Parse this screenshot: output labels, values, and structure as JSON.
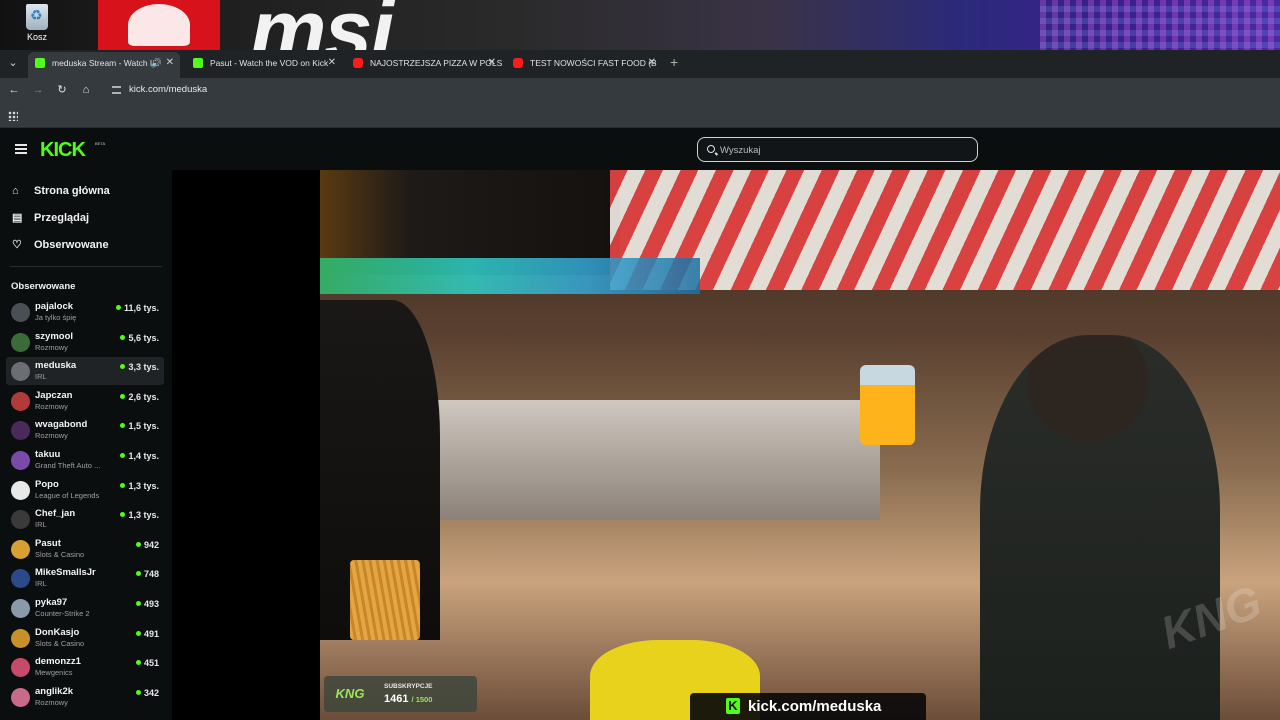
{
  "desktop": {
    "recycle_bin_label": "Kosz"
  },
  "browser": {
    "tabs": [
      {
        "title": "meduska Stream - Watch Li",
        "favicon": "kick-icon",
        "active": true
      },
      {
        "title": "Pasut - Watch the VOD on Kick",
        "favicon": "kick-icon",
        "active": false
      },
      {
        "title": "NAJOSTRZEJSZA PIZZA W POLS",
        "favicon": "youtube-icon",
        "active": false
      },
      {
        "title": "TEST NOWOŚCI FAST FOOD (B",
        "favicon": "youtube-icon",
        "active": false
      }
    ],
    "url": "kick.com/meduska"
  },
  "kick": {
    "logo": "KICK",
    "logo_badge": "BETA",
    "search_placeholder": "Wyszukaj",
    "nav": [
      {
        "label": "Strona główna",
        "icon": "home-icon"
      },
      {
        "label": "Przeglądaj",
        "icon": "browse-icon"
      },
      {
        "label": "Obserwowane",
        "icon": "heart-icon"
      }
    ],
    "followed_title": "Obserwowane",
    "channels": [
      {
        "name": "pajalock",
        "category": "Ja tylko śpię",
        "viewers": "11,6 tys.",
        "avatar_color": "#4a4f55"
      },
      {
        "name": "szymool",
        "category": "Rozmowy",
        "viewers": "5,6 tys.",
        "avatar_color": "#3c6b3a"
      },
      {
        "name": "meduska",
        "category": "IRL",
        "viewers": "3,3 tys.",
        "avatar_color": "#6b6f73",
        "selected": true
      },
      {
        "name": "Japczan",
        "category": "Rozmowy",
        "viewers": "2,6 tys.",
        "avatar_color": "#b23a3a"
      },
      {
        "name": "wvagabond",
        "category": "Rozmowy",
        "viewers": "1,5 tys.",
        "avatar_color": "#4a2a5a"
      },
      {
        "name": "takuu",
        "category": "Grand Theft Auto ...",
        "viewers": "1,4 tys.",
        "avatar_color": "#7a4aa8"
      },
      {
        "name": "Popo",
        "category": "League of Legends",
        "viewers": "1,3 tys.",
        "avatar_color": "#e8e8e8"
      },
      {
        "name": "Chef_jan",
        "category": "IRL",
        "viewers": "1,3 tys.",
        "avatar_color": "#3a3a3a"
      },
      {
        "name": "Pasut",
        "category": "Slots & Casino",
        "viewers": "942",
        "avatar_color": "#d8a030"
      },
      {
        "name": "MikeSmallsJr",
        "category": "IRL",
        "viewers": "748",
        "avatar_color": "#2a4a8a"
      },
      {
        "name": "pyka97",
        "category": "Counter-Strike 2",
        "viewers": "493",
        "avatar_color": "#8a9aa8"
      },
      {
        "name": "DonKasjo",
        "category": "Slots & Casino",
        "viewers": "491",
        "avatar_color": "#c8902a"
      },
      {
        "name": "demonzz1",
        "category": "Mewgenics",
        "viewers": "451",
        "avatar_color": "#c84a6a"
      },
      {
        "name": "anglik2k",
        "category": "Rozmowy",
        "viewers": "342",
        "avatar_color": "#c86a8a"
      }
    ]
  },
  "stream": {
    "sub_widget": {
      "label": "SUBSKRYPCJE",
      "count": "1461",
      "goal": "/ 1500"
    },
    "banner": "kick.com/meduska"
  }
}
